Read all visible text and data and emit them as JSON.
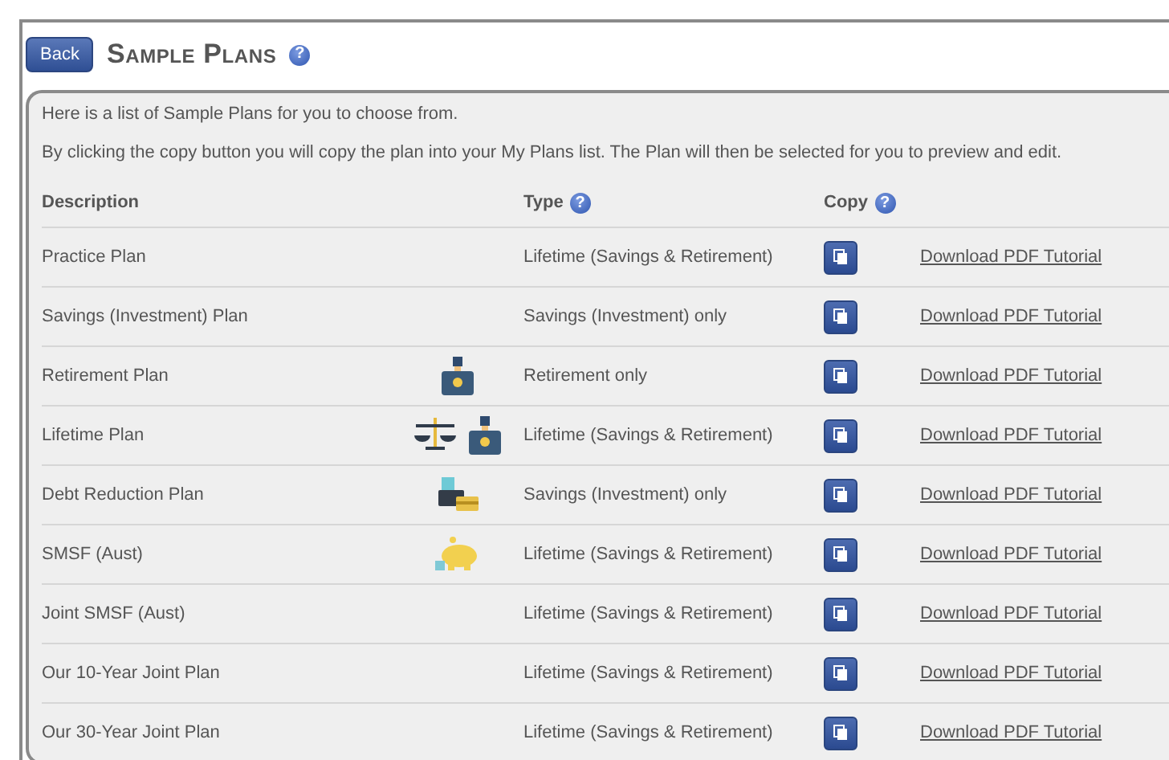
{
  "header": {
    "back_button": "Back",
    "title": "Sample Plans",
    "help": "?"
  },
  "intro": [
    "Here is a list of Sample Plans for you to choose from.",
    "By clicking the copy button you will copy the plan into your My Plans list. The Plan will then be selected for you to preview and edit."
  ],
  "table": {
    "columns": [
      {
        "label": "Description",
        "help": false
      },
      {
        "label": "Type",
        "help": true
      },
      {
        "label": "Copy",
        "help": true
      }
    ],
    "rows": [
      {
        "description": "Practice Plan",
        "icons": [],
        "type": "Lifetime (Savings & Retirement)",
        "link": "Download PDF Tutorial"
      },
      {
        "description": "Savings (Investment) Plan",
        "icons": [],
        "type": "Savings (Investment) only",
        "link": "Download PDF Tutorial"
      },
      {
        "description": "Retirement Plan",
        "icons": [
          {
            "kind": "bag"
          }
        ],
        "type": "Retirement only",
        "link": "Download PDF Tutorial"
      },
      {
        "description": "Lifetime Plan",
        "icons": [
          {
            "kind": "scales"
          },
          {
            "kind": "bag"
          }
        ],
        "type": "Lifetime (Savings & Retirement)",
        "link": "Download PDF Tutorial"
      },
      {
        "description": "Debt Reduction Plan",
        "icons": [
          {
            "kind": "cards"
          }
        ],
        "type": "Savings (Investment) only",
        "link": "Download PDF Tutorial"
      },
      {
        "description": "SMSF (Aust)",
        "icons": [
          {
            "kind": "piggy"
          }
        ],
        "type": "Lifetime (Savings & Retirement)",
        "link": "Download PDF Tutorial"
      },
      {
        "description": "Joint SMSF (Aust)",
        "icons": [],
        "type": "Lifetime (Savings & Retirement)",
        "link": "Download PDF Tutorial"
      },
      {
        "description": "Our 10-Year Joint Plan",
        "icons": [],
        "type": "Lifetime (Savings & Retirement)",
        "link": "Download PDF Tutorial"
      },
      {
        "description": "Our 30-Year Joint Plan",
        "icons": [],
        "type": "Lifetime (Savings & Retirement)",
        "link": "Download PDF Tutorial"
      }
    ]
  }
}
